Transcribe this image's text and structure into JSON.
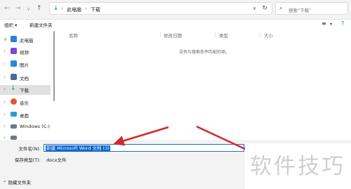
{
  "address": {
    "crumbs": [
      "此电脑",
      "下载"
    ],
    "search_placeholder": "搜索\"下载\""
  },
  "toolbar": {
    "organize_label": "组织 ▾",
    "new_folder_label": "新建文件夹"
  },
  "sidebar": {
    "items": [
      {
        "label": "此电脑",
        "icon": "pc-icon",
        "color": "#2a7fd4"
      },
      {
        "label": "视频",
        "icon": "video-icon",
        "color": "#7b4bd4"
      },
      {
        "label": "图片",
        "icon": "pictures-icon",
        "color": "#2a8ad4"
      },
      {
        "label": "文档",
        "icon": "documents-icon",
        "color": "#4a6a9a"
      },
      {
        "label": "下载",
        "icon": "download-icon",
        "color": "#1a8a5a"
      },
      {
        "label": "音乐",
        "icon": "music-icon",
        "color": "#e05a2a"
      },
      {
        "label": "桌面",
        "icon": "desktop-icon",
        "color": "#2a9ad4"
      },
      {
        "label": "Windows (C:)",
        "icon": "drive-icon",
        "color": "#6a7a8a"
      },
      {
        "label": "",
        "icon": "drive-icon",
        "color": "#6a7a8a"
      }
    ]
  },
  "columns": [
    "名称",
    "修改日期",
    "类型",
    "大小"
  ],
  "empty_message": "没有与搜索条件匹配的项。",
  "save": {
    "filename_label": "文件名(N):",
    "filename_value": "新建 Microsoft Word 文档 (3)",
    "filetype_label": "保存类型(T):",
    "filetype_value": "docx文件",
    "hide_folders_label": "隐藏文件夹"
  },
  "watermark": "软件技巧",
  "colors": {
    "accent": "#0a64c9",
    "arrow": "#d42828"
  }
}
